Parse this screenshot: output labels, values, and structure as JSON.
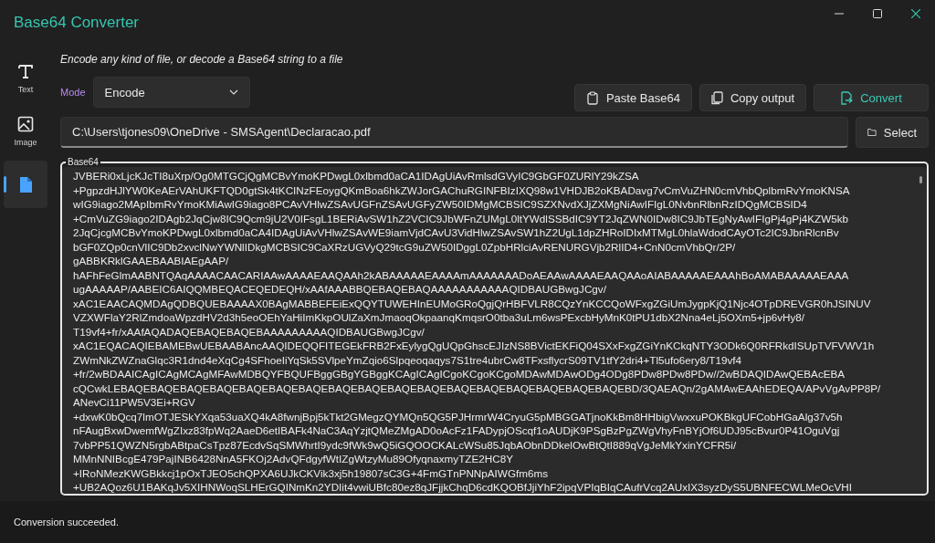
{
  "window": {
    "title": "Base64 Converter"
  },
  "nav": [
    {
      "label": "Text",
      "kind": "text",
      "selected": false
    },
    {
      "label": "Image",
      "kind": "image",
      "selected": false
    },
    {
      "kind": "file",
      "selected": true
    }
  ],
  "subtitle": "Encode any kind of file, or decode a Base64 string to a file",
  "mode": {
    "label": "Mode",
    "value": "Encode"
  },
  "buttons": [
    {
      "label": "Paste Base64",
      "kind": "paste"
    },
    {
      "label": "Copy output",
      "kind": "copy"
    },
    {
      "label": "Convert",
      "kind": "convert"
    }
  ],
  "file": {
    "value": "C:\\Users\\tjones09\\OneDrive - SMSAgent\\Declaracao.pdf"
  },
  "select_button": "Select",
  "output": {
    "label": "Base64",
    "lines": [
      "JVBERi0xLjcKJcTI8uXrp/Og0MTGCjQgMCBvYmoKPDwgL0xlbmd0aCA1IDAgUiAvRmlsdGVyIC9GbGF0ZURlY29kZSA",
      "+PgpzdHJlYW0KeAErVAhUKFTQD0gtSk4tKCINzFEoygQKmBoa6hkZWJorGAChuRGINFBIzIXQ98w1VHDJB2oKBADavg7vCmVuZHN0cmVhbQplbmRvYmoKNSA",
      "wIG9iago2MApIbmRvYmoKMiAwIG9iago8PCAvVHlwZSAvUGFnZSAvUGFyZW50IDMgMCBSIC9SZXNvdXJjZXMgNiAwIFIgL0NvbnRlbnRzIDQgMCBSID4",
      "+CmVuZG9iago2IDAgb2JqCjw8IC9Qcm9jU2V0IFsgL1BERiAvSW1hZ2VCIC9JbWFnZUMgL0ltYWdlSSBdIC9YT2JqZWN0IDw8IC9JbTEgNyAwIFIgPj4gPj4KZW5kb",
      "2JqCjcgMCBvYmoKPDwgL0xlbmd0aCA4IDAgUiAvVHlwZSAvWE9iamVjdCAvU3VidHlwZSAvSW1hZ2UgL1dpZHRoIDIxMTMgL0hlaWdodCAyOTc2IC9JbnRlcnBv",
      "bGF0ZQp0cnVlIC9Db2xvclNwYWNlIDkgMCBSIC9CaXRzUGVyQ29tcG9uZW50IDggL0ZpbHRlciAvRENURGVjb2RlID4+CnN0cmVhbQr/2P/",
      "gABBKRklGAAEBAABIAEgAAP/",
      "hAFhFeGlmAABNTQAqAAAACAACARIAAwAAAAEAAQAAh2kABAAAAAEAAAAmAAAAAAADoAEAAwAAAAEAAQAAoAIABAAAAAEAAAhBoAMABAAAAAEAAA",
      "ugAAAAAP/AABEIC6AIQQMBEQACEQEDEQH/xAAfAAABBQEBAQEBAQAAAAAAAAAAAQIDBAUGBwgJCgv/",
      "xAC1EAACAQMDAgQDBQUEBAAAAX0BAgMABBEFEiExQQYTUWEHInEUMoGRoQgjQrHBFVLR8CQzYnKCCQoWFxgZGiUmJygpKjQ1Njc4OTpDREVGR0hJSINUV",
      "VZXWFlaY2RlZmdoaWpzdHV2d3h5eoOEhYaHiImKkpOUlZaXmJmaoqOkpaanqKmqsrO0tba3uLm6wsPExcbHyMnK0tPU1dbX2Nna4eLj5OXm5+jp6vHy8/",
      "T19vf4+fr/xAAfAQADAQEBAQEBAQEBAAAAAAAAAQIDBAUGBwgJCgv/",
      "xAC1EQACAQIEBAMEBwUEBAABAncAAQIDEQQFITEGEkFRB2FxEylygQgUQpGhscEJIzNS8BVictEKFiQ04SXxFxgZGiYnKCkqNTY3ODk6Q0RFRkdISUpTVFVWV1h",
      "ZWmNkZWZnaGlqc3R1dnd4eXqCg4SFhoeIiYqSk5SVlpeYmZqio6Slpqeoqaqys7S1tre4ubrCw8TFxsflycrS09TV1tfY2dri4+Tl5ufo6ery8/T19vf4",
      "+fr/2wBDAAICAgICAgMCAgMFAwMDBQYFBQUFBggGBgYGBggKCAgICAgICgoKCgoKCgoMDAwMDAwODg4ODg8PDw8PDw8PDw//2wBDAQIDAwQEBAcEBA",
      "cQCwkLEBAQEBAQEBAQEBAQEBAQEBAQEBAQEBAQEBAQEBAQEBAQEBAQEBAQEBAQEBAQEBAQEBAQEBD/3QAEAQn/2gAMAwEAAhEDEQA/APvVgAvPP8P/",
      "ANevCi11PW5V3Ei+RGV",
      "+dxwK0bQcq7lmOTJESkYXqa53uaXQ4kA8fwnjBpj5kTkt2GMegzQYMQn5QG5PJHrmrW4CryuG5pMBGGATjnoKkBm8HHbigVwxxuPOKBkgUFCobHGaAlg37v5h",
      "nFAugBxwDwemfWgZIxz83fpWq2AaeD6etIBAFk4NaC3AqYzjtQMeZMgAD0oAcFz1FADypjOScqf1oAUDjK9PSgBzPgZWgVhyFnBYjOf6UDJ95cBvur0P41OguVgj",
      "7vbPP51QWZN5rgbABtpaCsTpz87EcdvSqSMWhrtI9ydc9fWk9wQ5iGQOOCKALcWSu85JqbAObnDDkelOwBtQtI889qVgJeMkYxinYCFR5i/",
      "MMnNNIBcgE479PajINB6428NnA5FKOj2AdvQFdgyfWtIZgWtzyMu89OfyqnaxmyTZE2HC8Y",
      "+IRoNMezKWGBkkcj1pOxTJEO5chQPXA6UJkCKVik3xj5h19807sC3G+4FmGTnPNNpAIWGfm6ms",
      "+UB2AQoz6U1BAKqJv5XIHNWoqSLHErGQINmKn2YDIit4vwiUBfc80ez8qJFjjkChqD6cdKQOBfJjiYhF2ipqVPIqBIqCAufrVcq2AUxIX3syzDyS5UBNFECWLMeOcVHI"
    ]
  },
  "status": "Conversion succeeded."
}
